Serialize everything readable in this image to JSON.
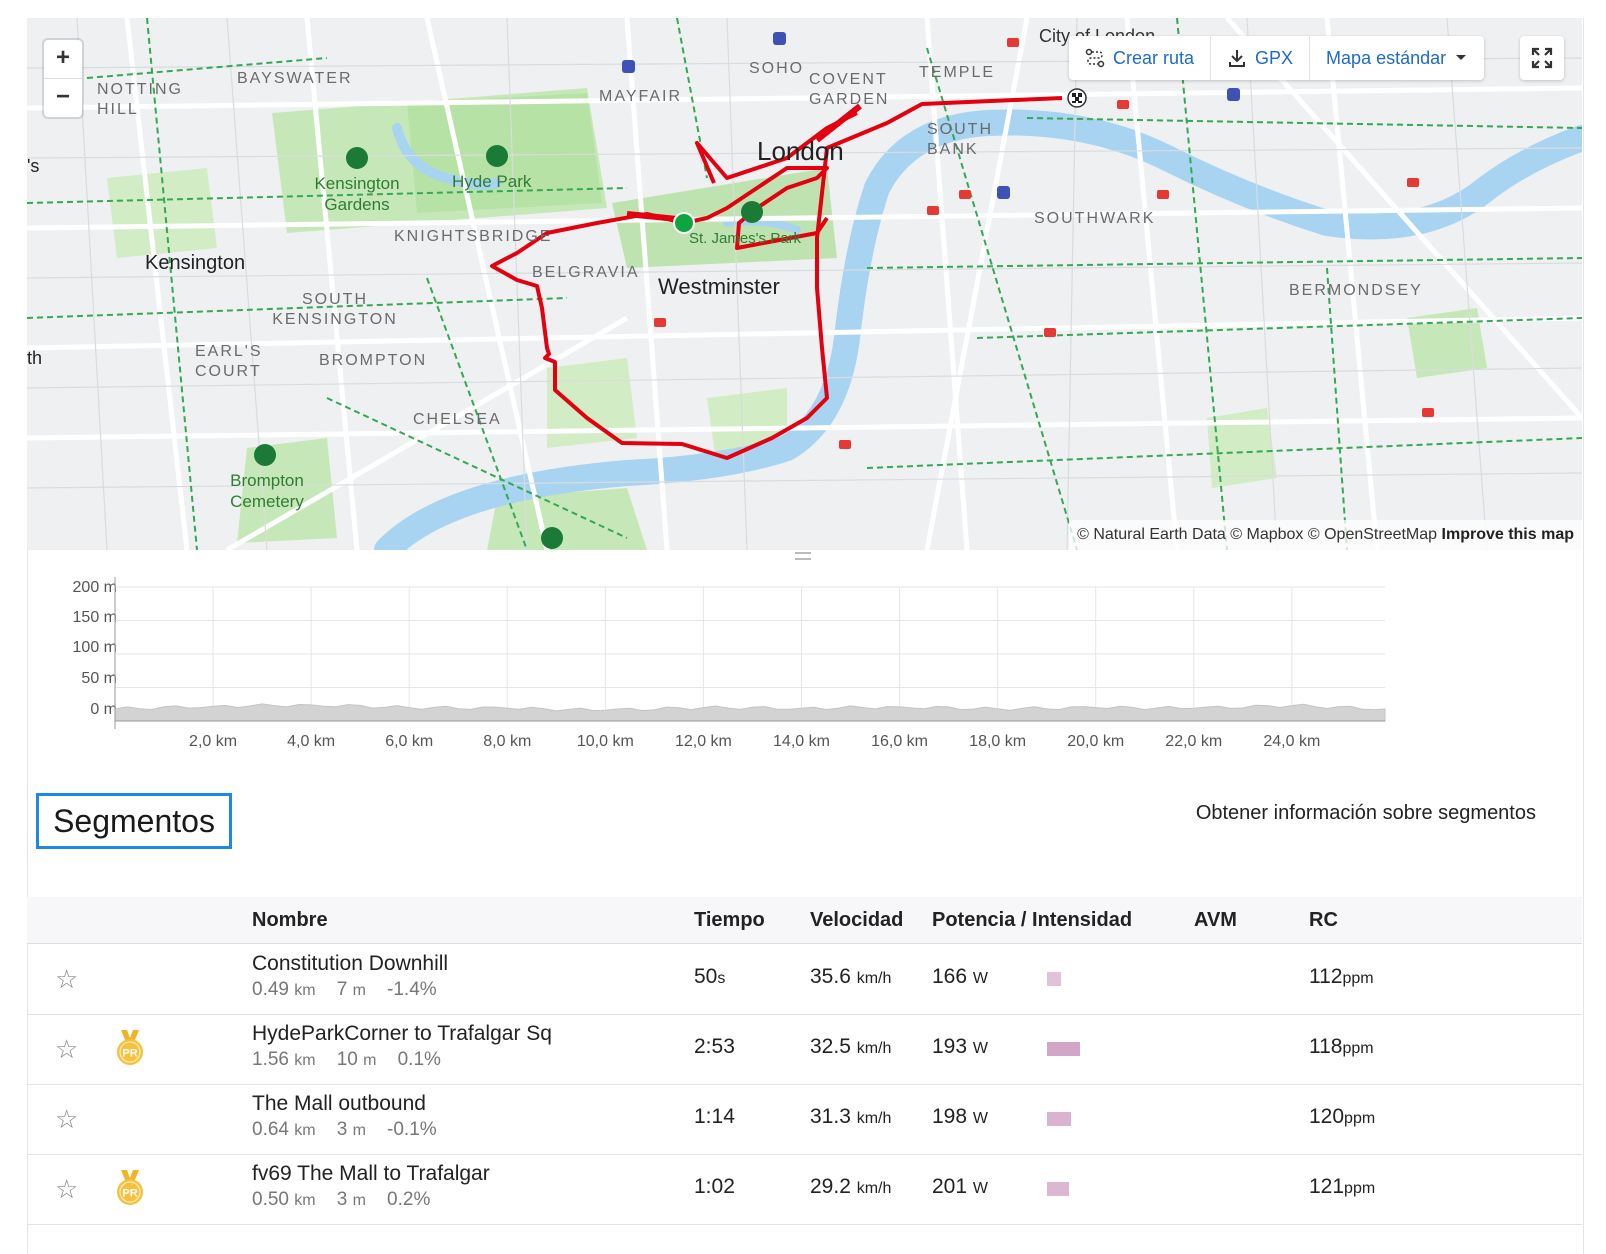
{
  "map": {
    "zoom_in": "+",
    "zoom_out": "−",
    "toolbar": {
      "create_route": "Crear ruta",
      "gpx": "GPX",
      "map_style": "Mapa estándar"
    },
    "attribution_plain": "© Natural Earth Data © Mapbox © OpenStreetMap",
    "attribution_bold": "Improve this map",
    "labels": {
      "city_of_london": "City of London",
      "notting_hill": "NOTTING HILL",
      "bayswater": "BAYSWATER",
      "mayfair": "MAYFAIR",
      "soho": "SOHO",
      "covent_garden": "COVENT GARDEN",
      "temple": "TEMPLE",
      "south_bank": "SOUTH BANK",
      "london": "London",
      "kensington_gardens": "Kensington Gardens",
      "hyde_park": "Hyde Park",
      "knightsbridge": "KNIGHTSBRIDGE",
      "st_james_park": "St. James's Park",
      "southwark": "SOUTHWARK",
      "kensington": "Kensington",
      "belgravia": "BELGRAVIA",
      "westminster": "Westminster",
      "bermondsey": "BERMONDSEY",
      "south_kensington": "SOUTH KENSINGTON",
      "earls_court": "EARL'S COURT",
      "brompton": "BROMPTON",
      "chelsea": "CHELSEA",
      "brompton_cemetery": "Brompton Cemetery",
      "edge_s": "'s",
      "edge_th": "th"
    }
  },
  "elevation": {
    "y_ticks": [
      "200 m",
      "150 m",
      "100 m",
      "50 m",
      "0 m"
    ],
    "x_ticks": [
      "2,0 km",
      "4,0 km",
      "6,0 km",
      "8,0 km",
      "10,0 km",
      "12,0 km",
      "14,0 km",
      "16,0 km",
      "18,0 km",
      "20,0 km",
      "22,0 km",
      "24,0 km"
    ]
  },
  "chart_data": {
    "type": "area",
    "x": [
      0,
      2,
      4,
      6,
      8,
      10,
      12,
      14,
      16,
      18,
      20,
      22,
      24,
      25.9
    ],
    "values": [
      18,
      22,
      24,
      20,
      19,
      16,
      20,
      19,
      21,
      18,
      20,
      19,
      23,
      18
    ],
    "xlabel": "",
    "ylabel": "",
    "xlim": [
      0,
      25.9
    ],
    "ylim": [
      0,
      200
    ],
    "grid": true
  },
  "segments": {
    "title": "Segmentos",
    "info_link": "Obtener información sobre segmentos",
    "headers": {
      "name": "Nombre",
      "time": "Tiempo",
      "speed": "Velocidad",
      "power": "Potencia / Intensidad",
      "vam": "AVM",
      "hr": "RC"
    },
    "rows": [
      {
        "name": "Constitution Downhill",
        "dist": "0.49",
        "dist_u": "km",
        "elev": "7",
        "elev_u": "m",
        "grade": "-1.4%",
        "time": "50",
        "time_u": "s",
        "speed": "35.6",
        "speed_u": "km/h",
        "power": "166",
        "power_u": "W",
        "intensity": 0.27,
        "hr": "112",
        "hr_u": "ppm",
        "pr": false
      },
      {
        "name": "HydeParkCorner to Trafalgar Sq",
        "dist": "1.56",
        "dist_u": "km",
        "elev": "10",
        "elev_u": "m",
        "grade": "0.1%",
        "time": "2:53",
        "time_u": "",
        "speed": "32.5",
        "speed_u": "km/h",
        "power": "193",
        "power_u": "W",
        "intensity": 0.64,
        "hr": "118",
        "hr_u": "ppm",
        "pr": true,
        "pr_label": "PR"
      },
      {
        "name": "The Mall outbound",
        "dist": "0.64",
        "dist_u": "km",
        "elev": "3",
        "elev_u": "m",
        "grade": "-0.1%",
        "time": "1:14",
        "time_u": "",
        "speed": "31.3",
        "speed_u": "km/h",
        "power": "198",
        "power_u": "W",
        "intensity": 0.47,
        "hr": "120",
        "hr_u": "ppm",
        "pr": false
      },
      {
        "name": "fv69 The Mall to Trafalgar",
        "dist": "0.50",
        "dist_u": "km",
        "elev": "3",
        "elev_u": "m",
        "grade": "0.2%",
        "time": "1:02",
        "time_u": "",
        "speed": "29.2",
        "speed_u": "km/h",
        "power": "201",
        "power_u": "W",
        "intensity": 0.42,
        "hr": "121",
        "hr_u": "ppm",
        "pr": true,
        "pr_label": "PR"
      }
    ]
  },
  "colors": {
    "route": "#e3000f",
    "accent": "#1e88e5",
    "park": "#bfe3b0",
    "river": "#a8d4f2",
    "bike_lane": "#34a853",
    "intensity_bar": "#c58bb6"
  }
}
